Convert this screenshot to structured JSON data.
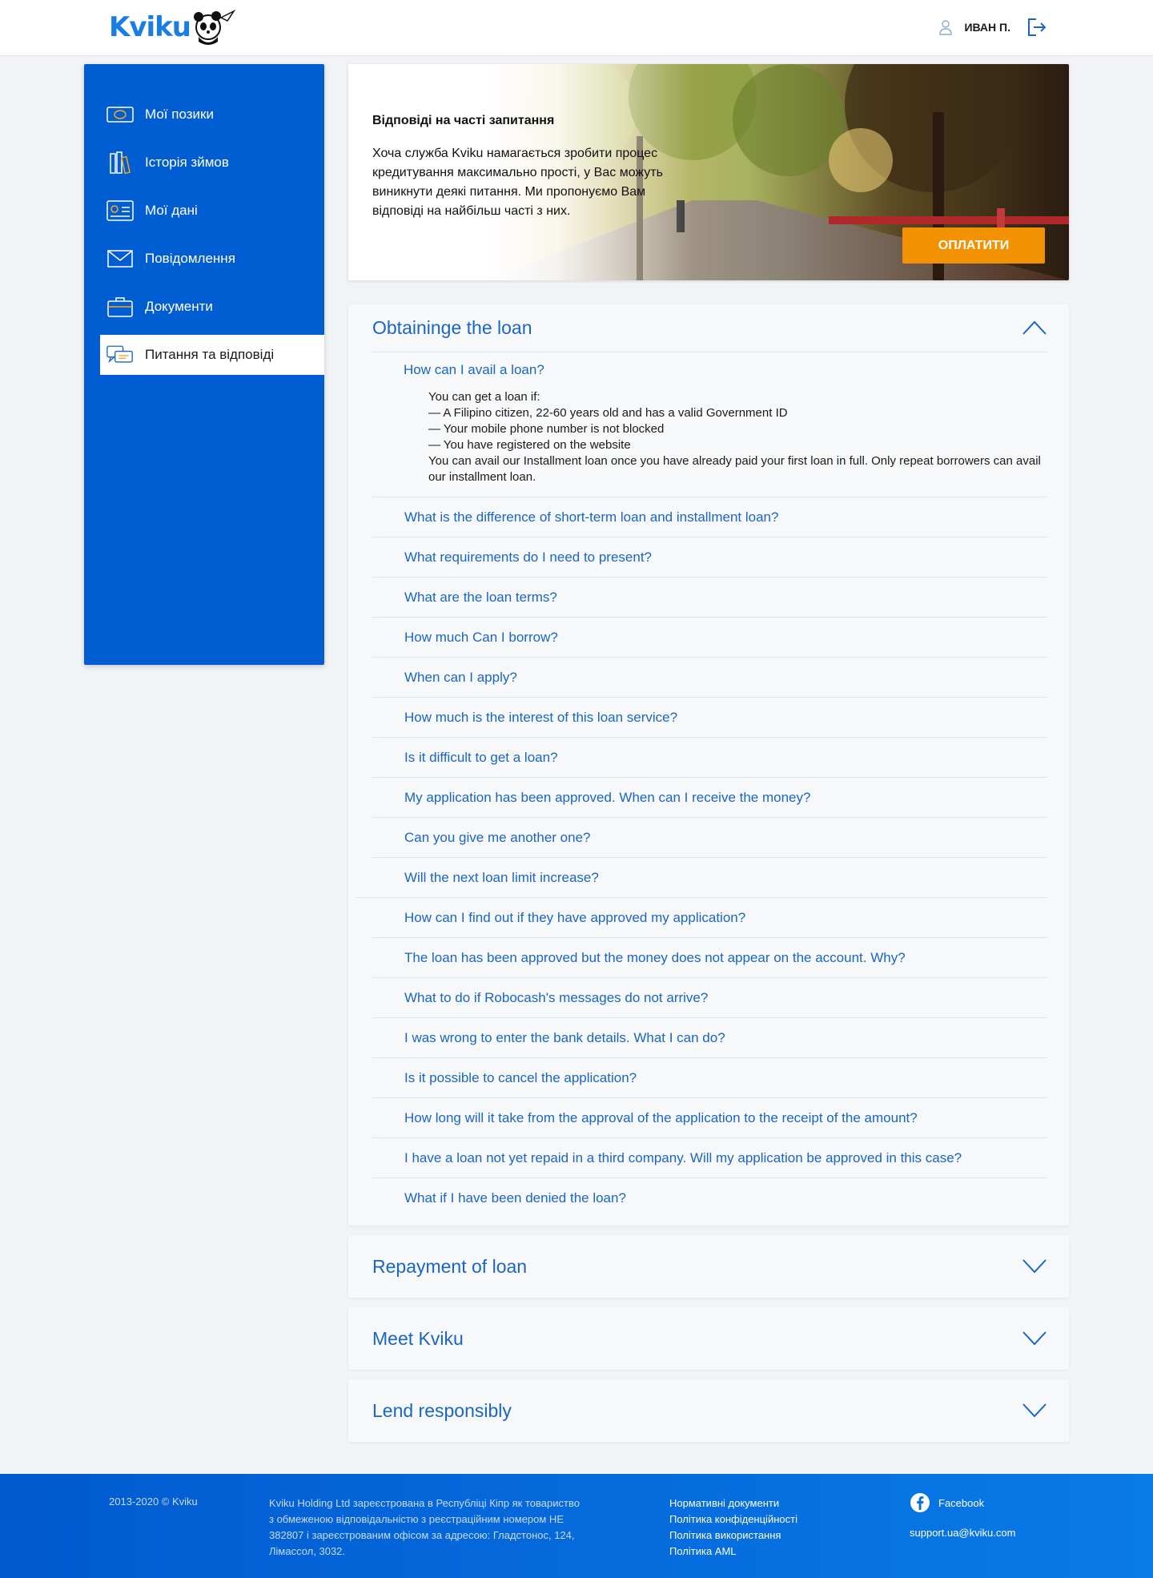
{
  "header": {
    "logo_text": "Kviku",
    "user_name": "ИВАН П."
  },
  "sidebar": {
    "items": [
      {
        "label": "Мої позики",
        "icon": "money-icon"
      },
      {
        "label": "Історія зймов",
        "icon": "books-icon"
      },
      {
        "label": "Мої дані",
        "icon": "id-card-icon"
      },
      {
        "label": "Повідомлення",
        "icon": "envelope-icon"
      },
      {
        "label": "Документи",
        "icon": "briefcase-icon"
      },
      {
        "label": "Питання та відповіді",
        "icon": "chat-icon",
        "active": true
      }
    ]
  },
  "banner": {
    "title": "Відповіді на часті запитання",
    "text": "Хоча служба Kviku намагається зробити процес кредитування максимально прості, у Вас можуть виникнути деякі питання. Ми пропонуємо Вам відповіді на найбільш часті з них.",
    "pay_button": "ОПЛАТИТИ"
  },
  "faq": {
    "open_section": {
      "title": "Obtaininge the loan",
      "open_question": "How can I avail a loan?",
      "answer_lines": [
        "You can get a loan if:",
        "— A Filipino citizen, 22-60 years old and has a valid Government ID",
        "— Your mobile phone number is not blocked",
        "— You have registered on the website",
        "You can avail our Installment loan once you have already paid your first loan in full. Only repeat borrowers can avail our installment loan."
      ],
      "questions": [
        "What is the difference of short-term loan and installment loan?",
        "What requirements do I need to present?",
        "What are the loan terms?",
        "How much Can I borrow?",
        "When can I apply?",
        "How much is the interest of this loan service?",
        "Is it difficult to get a loan?",
        "My application has been approved. When can I receive the money?",
        "Can you give me another one?",
        "Will the next loan limit increase?",
        "How can I find out if they have approved my application?",
        "The loan has been approved but the money does not appear on the account. Why?",
        "What to do if Robocash's messages do not arrive?",
        "I was wrong to enter the bank details. What I can do?",
        "Is it possible to cancel the application?",
        "How long will it take from the approval of the application to the receipt of the amount?",
        "I have a loan not yet repaid in a third company. Will my application be approved in this case?",
        "What if I have been denied the loan?"
      ]
    },
    "collapsed_sections": [
      {
        "title": "Repayment of loan"
      },
      {
        "title": "Meet Kviku"
      },
      {
        "title": "Lend responsibly"
      }
    ]
  },
  "footer": {
    "copyright": "2013-2020 © Kviku",
    "legal": "Kviku Holding Ltd зареєстрована в Республіці Кіпр як товариство з обмеженою відповідальністю з реєстраційним номером НЕ 382807 і зареєстрованим офісом за адресою: Гладстонос, 124, Лімассол, 3032.",
    "links": [
      "Нормативні документи",
      "Політика конфіденційності",
      "Політика використання",
      "Політика AML"
    ],
    "facebook": "Facebook",
    "email": "support.ua@kviku.com"
  },
  "colors": {
    "brand_blue": "#005dd2",
    "link_blue": "#1a66c2",
    "pay_orange": "#f39200"
  }
}
